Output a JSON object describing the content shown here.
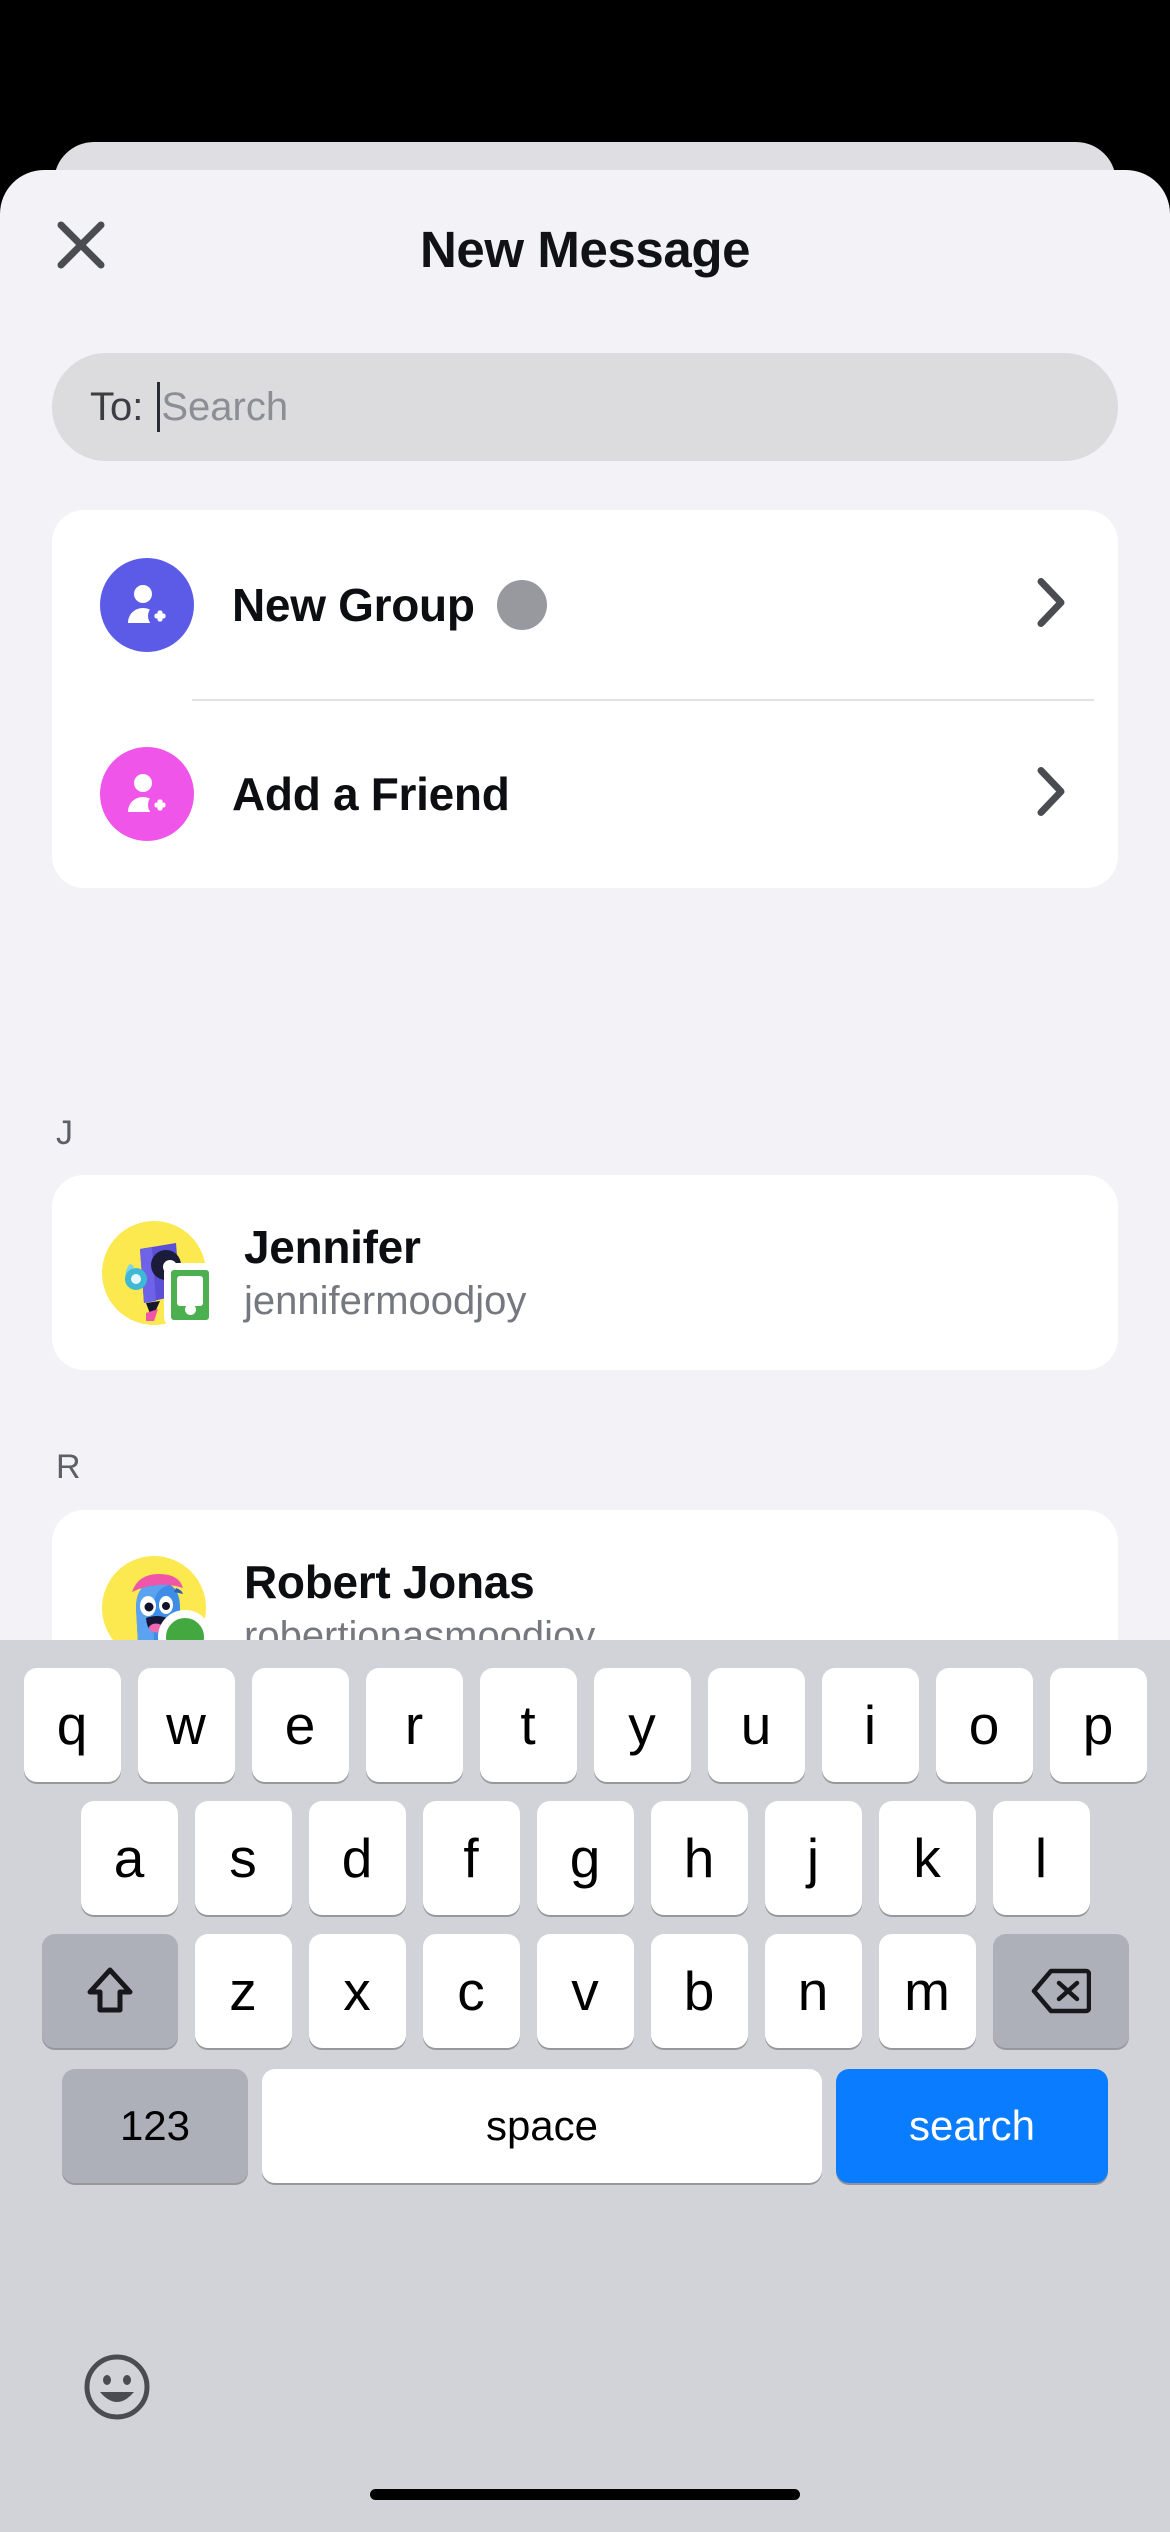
{
  "header": {
    "title": "New Message",
    "close_icon": "close-icon"
  },
  "search": {
    "to_label": "To:",
    "placeholder": "Search",
    "value": ""
  },
  "actions": [
    {
      "label": "New Group",
      "icon": "person-add-icon",
      "icon_color": "#5b5be8",
      "has_badge": true,
      "badge_color": "#97999e",
      "chevron": "chevron-right-icon"
    },
    {
      "label": "Add a Friend",
      "icon": "person-add-icon",
      "icon_color": "#ef55e8",
      "has_badge": false,
      "chevron": "chevron-right-icon"
    }
  ],
  "sections": [
    {
      "letter": "J",
      "contacts": [
        {
          "name": "Jennifer",
          "handle": "jennifermoodjoy",
          "avatar_bg": "#fbe94f",
          "badge": "phone-icon",
          "badge_color": "#4caf50"
        }
      ]
    },
    {
      "letter": "R",
      "contacts": [
        {
          "name": "Robert Jonas",
          "handle": "robertjonasmoodjoy",
          "avatar_bg": "#fbe94f",
          "badge": "online-status-dot",
          "badge_color": "#43a83f"
        }
      ]
    }
  ],
  "keyboard": {
    "row1": [
      "q",
      "w",
      "e",
      "r",
      "t",
      "y",
      "u",
      "i",
      "o",
      "p"
    ],
    "row2": [
      "a",
      "s",
      "d",
      "f",
      "g",
      "h",
      "j",
      "k",
      "l"
    ],
    "row3": [
      "z",
      "x",
      "c",
      "v",
      "b",
      "n",
      "m"
    ],
    "shift_icon": "shift-arrow-icon",
    "delete_icon": "backspace-icon",
    "numeric_label": "123",
    "space_label": "space",
    "return_label": "search",
    "return_color": "#0a7cff",
    "emoji_icon": "emoji-smiley-icon"
  }
}
